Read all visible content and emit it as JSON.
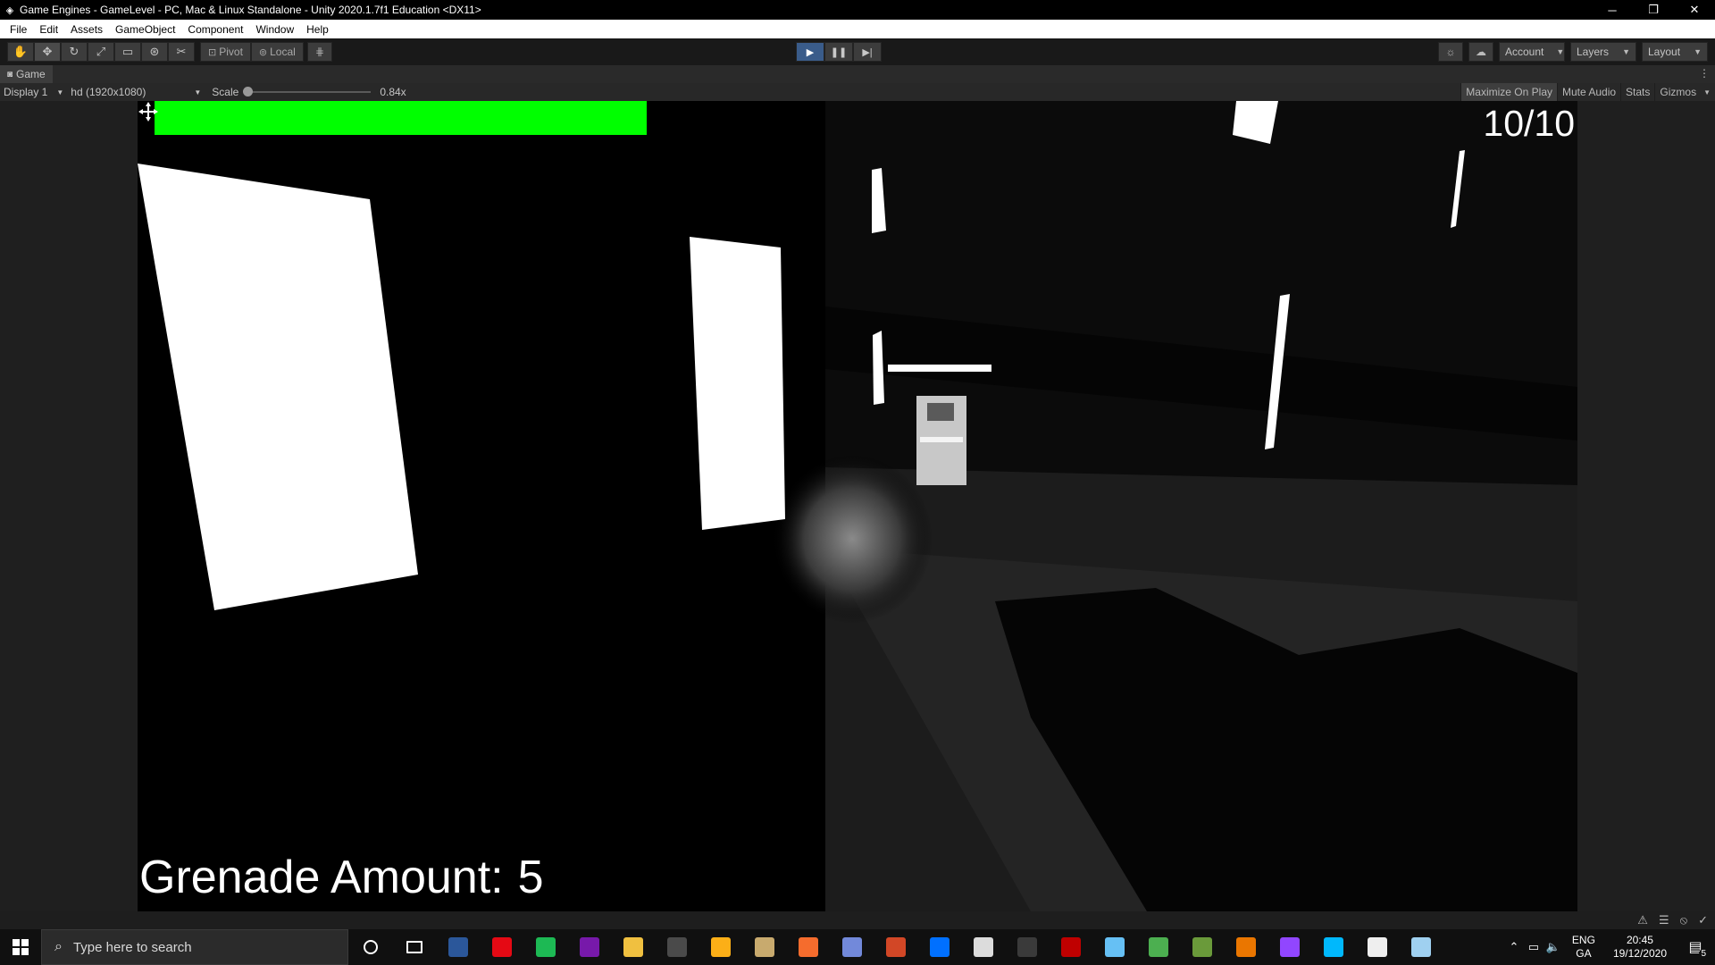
{
  "window": {
    "title": "Game Engines - GameLevel - PC, Mac & Linux Standalone - Unity 2020.1.7f1 Education <DX11>",
    "minimize": "─",
    "restore": "❐",
    "close": "✕"
  },
  "menu": [
    "File",
    "Edit",
    "Assets",
    "GameObject",
    "Component",
    "Window",
    "Help"
  ],
  "toolbar": {
    "pivot_label": "Pivot",
    "local_label": "Local",
    "account_label": "Account",
    "layers_label": "Layers",
    "layout_label": "Layout",
    "play_state": "playing"
  },
  "game_tab": {
    "label": "Game",
    "display": "Display 1",
    "resolution": "hd (1920x1080)",
    "scale_label": "Scale",
    "scale_value": "0.84x",
    "scale_fraction": 0.0,
    "maximize_on_play": "Maximize On Play",
    "mute_audio": "Mute Audio",
    "stats": "Stats",
    "gizmos": "Gizmos"
  },
  "hud": {
    "health_color": "#00ff00",
    "ammo": "10/10",
    "grenade_label": "Grenade Amount:",
    "grenade_count": "5"
  },
  "taskbar": {
    "search_placeholder": "Type here to search",
    "language": "ENG",
    "keyboard": "GA",
    "time": "20:45",
    "date": "19/12/2020",
    "notifications": "5",
    "apps": [
      {
        "name": "word-icon",
        "color": "#2b579a"
      },
      {
        "name": "netflix-icon",
        "color": "#e50914"
      },
      {
        "name": "spotify-icon",
        "color": "#1db954"
      },
      {
        "name": "onenote-icon",
        "color": "#7719aa"
      },
      {
        "name": "file-explorer-icon",
        "color": "#f0c040"
      },
      {
        "name": "hawk-icon",
        "color": "#4a4a4a"
      },
      {
        "name": "rockstar-icon",
        "color": "#fcaf17"
      },
      {
        "name": "league-icon",
        "color": "#c8aa6e"
      },
      {
        "name": "origin-icon",
        "color": "#f56c2d"
      },
      {
        "name": "discord-icon",
        "color": "#7289da"
      },
      {
        "name": "powerpoint-icon",
        "color": "#d24726"
      },
      {
        "name": "uplay-icon",
        "color": "#0070ff"
      },
      {
        "name": "torrent-icon",
        "color": "#dcdcdc"
      },
      {
        "name": "controller-icon",
        "color": "#3a3a3a"
      },
      {
        "name": "filezilla-icon",
        "color": "#bf0000"
      },
      {
        "name": "steam-icon",
        "color": "#66c0f4"
      },
      {
        "name": "chrome-icon",
        "color": "#4caf50"
      },
      {
        "name": "minecraft-icon",
        "color": "#6a9a3a"
      },
      {
        "name": "blender-icon",
        "color": "#ea7600"
      },
      {
        "name": "twitch-icon",
        "color": "#9146ff"
      },
      {
        "name": "logitech-icon",
        "color": "#00b8fc"
      },
      {
        "name": "unity-icon",
        "color": "#eeeeee"
      },
      {
        "name": "notepad-icon",
        "color": "#9fd0f0"
      }
    ]
  }
}
